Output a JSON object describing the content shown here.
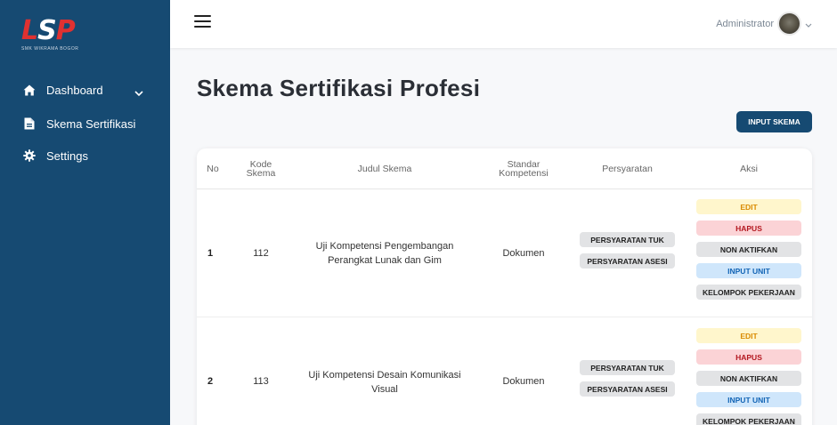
{
  "brand": {
    "logo_left": "L",
    "logo_mid": "S",
    "logo_right": "P",
    "logo_sub": "SMK WIKRAMA BOGOR"
  },
  "sidebar": {
    "items": [
      {
        "label": "Dashboard",
        "icon": "home-icon"
      },
      {
        "label": "Skema Sertifikasi",
        "icon": "document-icon"
      },
      {
        "label": "Settings",
        "icon": "gear-icon"
      }
    ]
  },
  "header": {
    "user_name": "Administrator"
  },
  "main": {
    "title": "Skema Sertifikasi Profesi",
    "input_button": "INPUT SKEMA",
    "columns": [
      "No",
      "Kode Skema",
      "Judul Skema",
      "Standar Kompetensi",
      "Persyaratan",
      "Aksi"
    ],
    "rows": [
      {
        "no": "1",
        "kode": "112",
        "judul": "Uji Kompetensi Pengembangan Perangkat Lunak dan Gim",
        "standar": "Dokumen",
        "persyaratan": [
          "PERSYARATAN TUK",
          "PERSYARATAN ASESI"
        ],
        "aksi": [
          "EDIT",
          "HAPUS",
          "NON AKTIFKAN",
          "INPUT UNIT",
          "KELOMPOK PEKERJAAN"
        ]
      },
      {
        "no": "2",
        "kode": "113",
        "judul": "Uji Kompetensi Desain Komunikasi Visual",
        "standar": "Dokumen",
        "persyaratan": [
          "PERSYARATAN TUK",
          "PERSYARATAN ASESI"
        ],
        "aksi": [
          "EDIT",
          "HAPUS",
          "NON AKTIFKAN",
          "INPUT UNIT",
          "KELOMPOK PEKERJAAN"
        ]
      }
    ]
  },
  "colors": {
    "sidebar": "#164a72",
    "accent_red": "#e03131",
    "primary": "#164a72"
  }
}
